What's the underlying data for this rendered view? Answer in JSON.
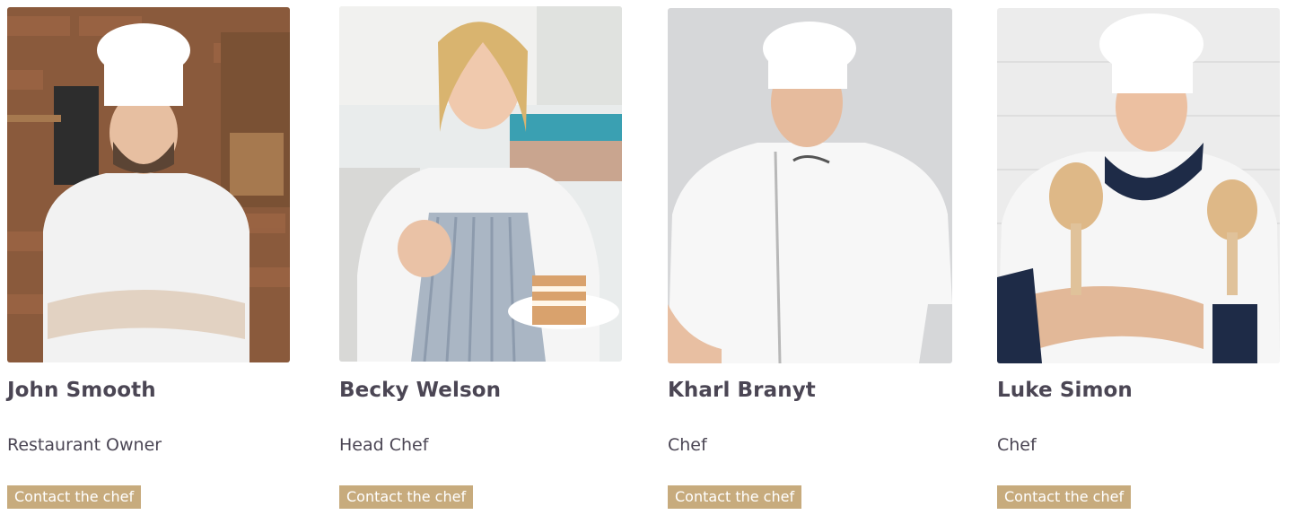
{
  "team": [
    {
      "name": "John Smooth",
      "role": "Restaurant Owner",
      "cta": "Contact the chef"
    },
    {
      "name": "Becky Welson",
      "role": "Head Chef",
      "cta": "Contact the chef"
    },
    {
      "name": "Kharl Branyt",
      "role": "Chef",
      "cta": "Contact the chef"
    },
    {
      "name": "Luke Simon",
      "role": "Chef",
      "cta": "Contact the chef"
    }
  ],
  "colors": {
    "accent": "#c7ab7d",
    "text": "#4b4654"
  },
  "icons": {
    "photo_1": "chef-portrait-brick-kitchen",
    "photo_2": "chef-portrait-thumbs-up-cake",
    "photo_3": "chef-portrait-grey-background",
    "photo_4": "chef-portrait-wooden-spoons"
  }
}
